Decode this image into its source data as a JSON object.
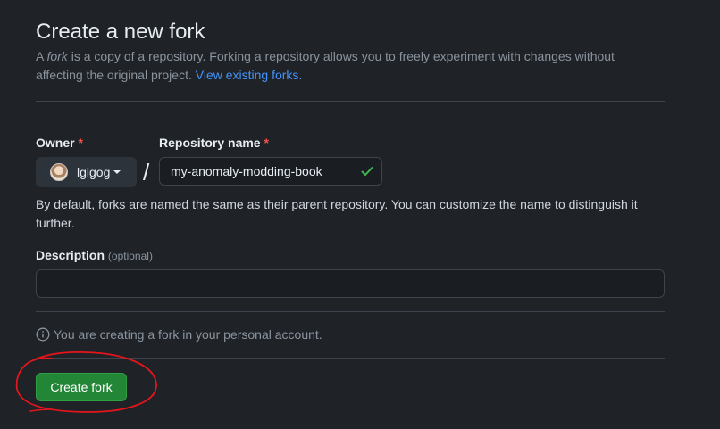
{
  "header": {
    "title": "Create a new fork",
    "subtitle_prefix": "A ",
    "subtitle_em": "fork",
    "subtitle_rest": " is a copy of a repository. Forking a repository allows you to freely experiment with changes without affecting the original project. ",
    "subtitle_link": "View existing forks."
  },
  "owner": {
    "label": "Owner",
    "required_mark": "*",
    "selected": "lgigog",
    "avatar_icon": "avatar"
  },
  "separator": "/",
  "repository": {
    "label": "Repository name",
    "required_mark": "*",
    "value": "my-anomaly-modding-book",
    "status_icon": "check-icon",
    "status_color": "#3fb950"
  },
  "help_text": "By default, forks are named the same as their parent repository. You can customize the name to distinguish it further.",
  "description": {
    "label": "Description",
    "optional": "(optional)",
    "value": "",
    "placeholder": ""
  },
  "info": {
    "icon": "info-icon",
    "text": "You are creating a fork in your personal account."
  },
  "actions": {
    "create_label": "Create fork",
    "create_color": "#238636"
  },
  "annotation": {
    "type": "hand-drawn circle",
    "color": "#e5151c",
    "target": "create-fork-button"
  }
}
